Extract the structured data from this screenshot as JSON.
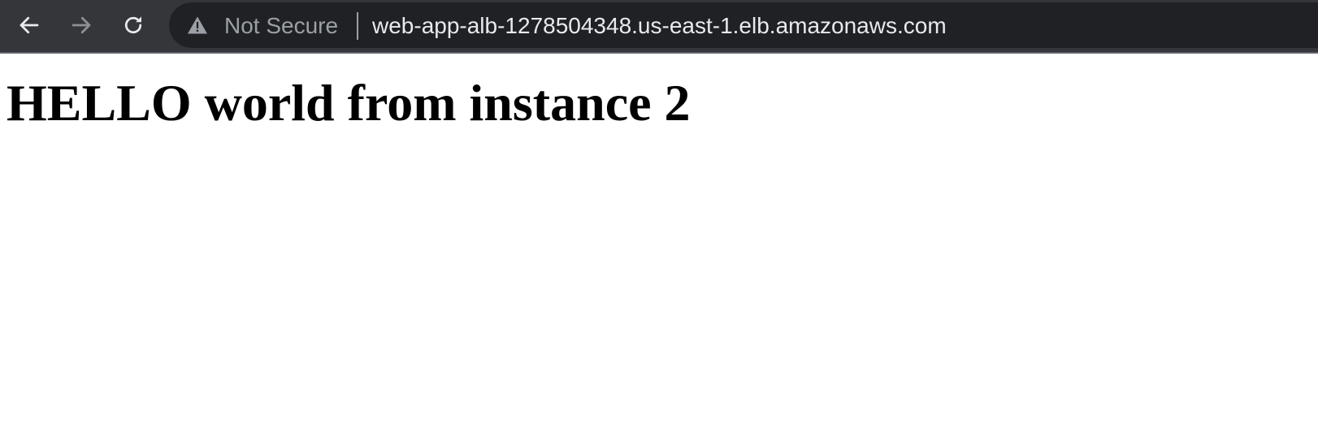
{
  "browser": {
    "toolbar": {
      "back_icon": "arrow-left-icon",
      "forward_icon": "arrow-right-icon",
      "reload_icon": "reload-icon"
    },
    "omnibox": {
      "security_icon": "warning-triangle-icon",
      "security_label": "Not Secure",
      "url": "web-app-alb-1278504348.us-east-1.elb.amazonaws.com"
    },
    "colors": {
      "toolbar_bg": "#35363a",
      "omnibox_bg": "#202124",
      "url_text": "#e8eaed",
      "muted_text": "#9aa0a6"
    }
  },
  "page": {
    "heading": "HELLO world from instance 2"
  }
}
